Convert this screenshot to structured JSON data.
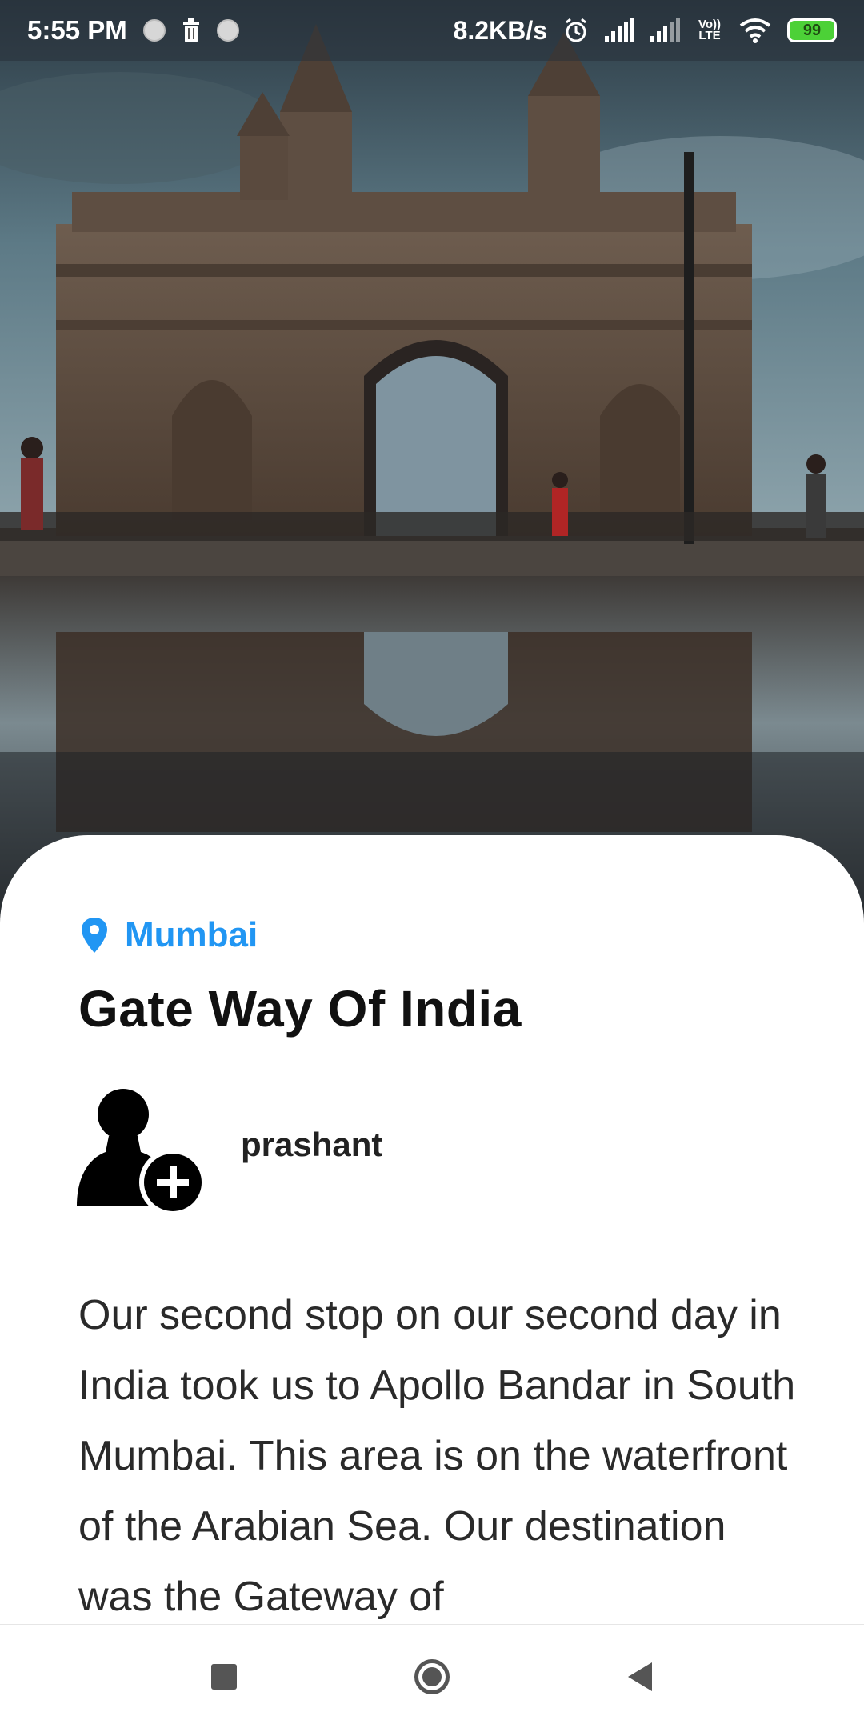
{
  "status_bar": {
    "time": "5:55 PM",
    "net_speed": "8.2KB/s",
    "volte_label": "Vo)) LTE",
    "battery_level": "99",
    "icons": [
      "notification-dot-icon",
      "trash-icon",
      "notification-dot-icon",
      "alarm-icon",
      "signal-icon",
      "signal-icon",
      "volte-icon",
      "wifi-icon",
      "battery-icon"
    ]
  },
  "hero": {
    "image_icon": "gateway-of-india-photo"
  },
  "place": {
    "location_icon": "location-pin-icon",
    "location": "Mumbai",
    "title": "Gate Way Of India"
  },
  "author": {
    "avatar_icon": "add-user-icon",
    "name": "prashant"
  },
  "description": "Our second stop on our second day in India took us to Apollo Bandar in South Mumbai. This area is on the waterfront of the Arabian Sea. Our destination was the Gateway of",
  "nav_bar": {
    "buttons": [
      "recents-button",
      "home-button",
      "back-button"
    ]
  },
  "colors": {
    "accent": "#2196f3",
    "title_text": "#111111",
    "body_text": "#2a2a2a",
    "battery": "#4cd137"
  }
}
